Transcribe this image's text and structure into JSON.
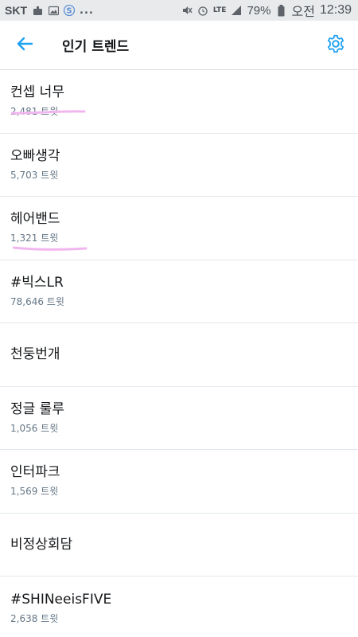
{
  "status_bar": {
    "carrier": "SKT",
    "dots": "...",
    "lte": "LTE",
    "battery": "79%",
    "am_pm": "오전",
    "time": "12:39"
  },
  "header": {
    "title": "인기 트렌드",
    "accent_color": "#1da1f2"
  },
  "trends": [
    {
      "name": "컨셉 너무",
      "count": "2,481 트윗",
      "highlighted": true
    },
    {
      "name": "오빠생각",
      "count": "5,703 트윗",
      "highlighted": false
    },
    {
      "name": "헤어밴드",
      "count": "1,321 트윗",
      "highlighted": true
    },
    {
      "name": "#빅스LR",
      "count": "78,646 트윗",
      "highlighted": false
    },
    {
      "name": "천둥번개",
      "count": "",
      "highlighted": false
    },
    {
      "name": "정글 룰루",
      "count": "1,056 트윗",
      "highlighted": false
    },
    {
      "name": "인터파크",
      "count": "1,569 트윗",
      "highlighted": false
    },
    {
      "name": "비정상회담",
      "count": "",
      "highlighted": false
    },
    {
      "name": "#SHINeeisFIVE",
      "count": "2,638 트윗",
      "highlighted": false
    }
  ],
  "highlight_color": "#f2b6ef"
}
